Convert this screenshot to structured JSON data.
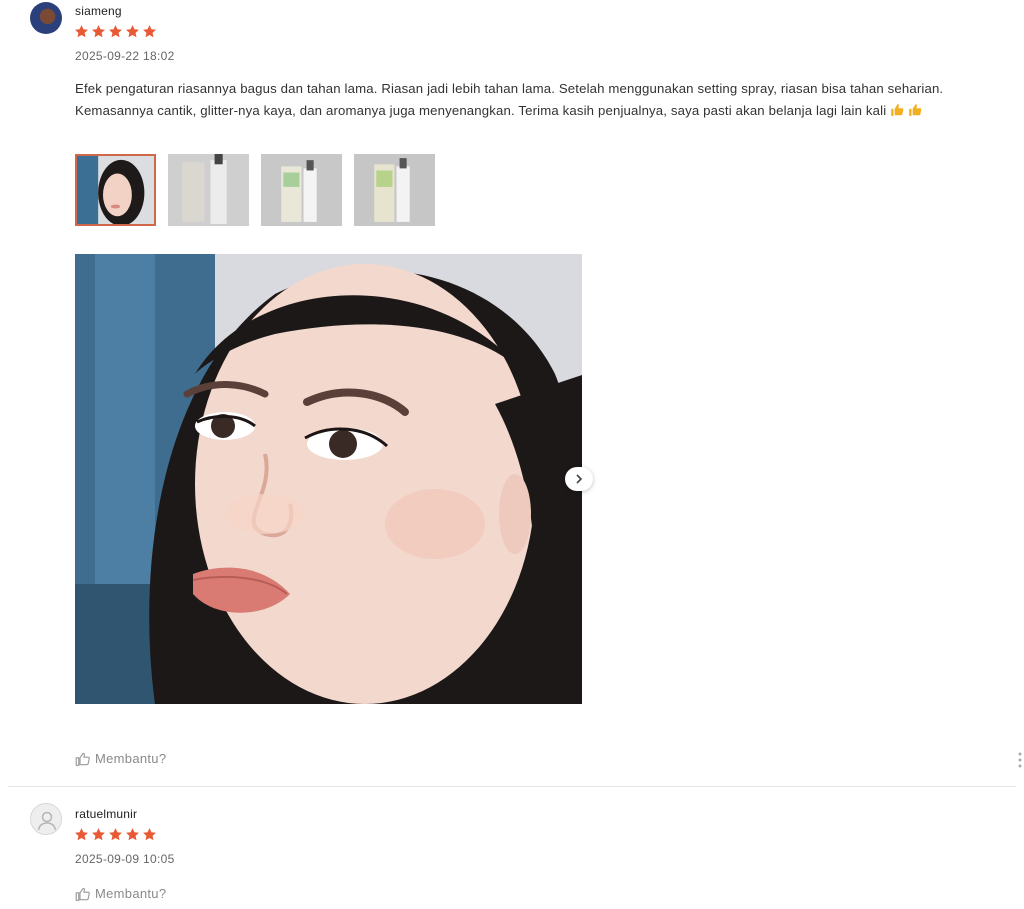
{
  "reviews": [
    {
      "username": "siameng",
      "rating": 5,
      "date": "2025-09-22 18:02",
      "text": "Efek pengaturan riasannya bagus dan tahan lama. Riasan jadi lebih tahan lama. Setelah menggunakan setting spray, riasan bisa tahan seharian. Kemasannya cantik, glitter-nya kaya, dan aromanya juga menyenangkan. Terima kasih penjualnya, saya pasti akan belanja lagi lain kali",
      "emoji_icons": [
        "thumbs-up-emoji",
        "thumbs-up-emoji"
      ],
      "thumbnails": [
        "selfie-photo",
        "product-photo",
        "product-photo",
        "product-photo"
      ],
      "selected_thumbnail": 0,
      "helpful_label": "Membantu?"
    },
    {
      "username": "ratuelmunir",
      "rating": 5,
      "date": "2025-09-09 10:05",
      "helpful_label": "Membantu?"
    }
  ],
  "colors": {
    "star": "#e85a35",
    "active_thumbnail_border": "#d0664a",
    "muted_text": "#8a8a8a"
  }
}
